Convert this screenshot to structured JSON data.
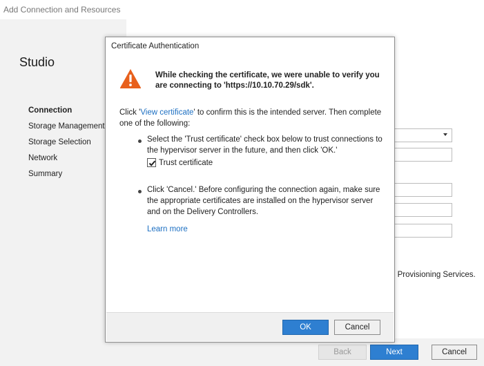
{
  "window": {
    "title": "Add Connection and Resources"
  },
  "sidebar": {
    "title": "Studio",
    "items": [
      {
        "label": "Connection",
        "active": true
      },
      {
        "label": "Storage Management",
        "active": false
      },
      {
        "label": "Storage Selection",
        "active": false
      },
      {
        "label": "Network",
        "active": false
      },
      {
        "label": "Summary",
        "active": false
      }
    ]
  },
  "background": {
    "provisioning_text": "g Provisioning Services."
  },
  "footer": {
    "back_label": "Back",
    "next_label": "Next",
    "cancel_label": "Cancel"
  },
  "dialog": {
    "title": "Certificate Authentication",
    "icon": "warning-icon",
    "headline": "While checking the certificate, we were unable to verify you are connecting to 'https://10.10.70.29/sdk'.",
    "intro_prefix": "Click '",
    "intro_link": "View certificate",
    "intro_suffix": "' to confirm this is the intended server. Then complete one of the following:",
    "bullet1": "Select the 'Trust certificate' check box below to trust connections to the hypervisor server in the future, and then click 'OK.'",
    "checkbox_label": "Trust certificate",
    "checkbox_checked": true,
    "bullet2": "Click 'Cancel.' Before configuring the connection again, make sure the appropriate certificates are installed on the hypervisor server and on the Delivery Controllers.",
    "learn_more": "Learn more",
    "ok_label": "OK",
    "cancel_label": "Cancel"
  },
  "colors": {
    "accent": "#2e7fd1",
    "link": "#1c6fc2",
    "warning": "#e8601c",
    "sidebar_bg": "#f2f2f2"
  }
}
